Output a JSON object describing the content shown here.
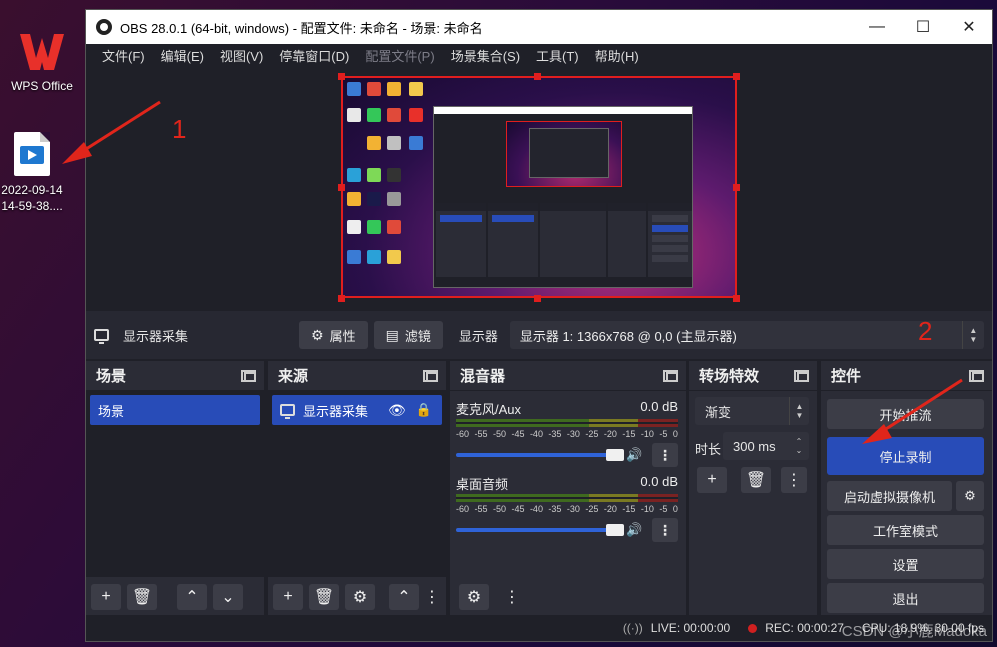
{
  "desktop": {
    "icons": [
      {
        "label": "WPS Office"
      },
      {
        "label_line1": "2022-09-14",
        "label_line2": "14-59-38...."
      }
    ]
  },
  "annotations": {
    "num1": "1",
    "num2": "2"
  },
  "window": {
    "title": "OBS 28.0.1 (64-bit, windows) - 配置文件: 未命名 - 场景: 未命名",
    "controls": {
      "minimize": "—",
      "maximize": "☐",
      "close": "✕"
    }
  },
  "menu": [
    "文件(F)",
    "编辑(E)",
    "视图(V)",
    "停靠窗口(D)",
    "配置文件(P)",
    "场景集合(S)",
    "工具(T)",
    "帮助(H)"
  ],
  "source_toolbar": {
    "source_name": "显示器采集",
    "properties_label": "属性",
    "filters_label": "滤镜",
    "display_label": "显示器",
    "display_value": "显示器 1: 1366x768 @ 0,0 (主显示器)"
  },
  "scenes": {
    "title": "场景",
    "items": [
      "场景"
    ]
  },
  "sources": {
    "title": "来源",
    "items": [
      "显示器采集"
    ]
  },
  "mixer": {
    "title": "混音器",
    "ticks": [
      "-60",
      "-55",
      "-50",
      "-45",
      "-40",
      "-35",
      "-30",
      "-25",
      "-20",
      "-15",
      "-10",
      "-5",
      "0"
    ],
    "tracks": [
      {
        "name": "麦克风/Aux",
        "db": "0.0 dB"
      },
      {
        "name": "桌面音频",
        "db": "0.0 dB"
      }
    ]
  },
  "transitions": {
    "title": "转场特效",
    "selected": "渐变",
    "duration_label": "时长",
    "duration_value": "300 ms"
  },
  "controls": {
    "title": "控件",
    "start_stream": "开始推流",
    "stop_record": "停止录制",
    "virtual_cam": "启动虚拟摄像机",
    "studio_mode": "工作室模式",
    "settings": "设置",
    "exit": "退出"
  },
  "status": {
    "live": "LIVE: 00:00:00",
    "rec": "REC: 00:00:27",
    "cpu": "CPU: 18.9%, 30.00 fps"
  },
  "watermark": "CSDN @小鹿Madoka",
  "colors": {
    "accent": "#284cb8",
    "selection_red": "#e01e1e",
    "panel": "#2b2c36",
    "bg": "#1f2028"
  }
}
